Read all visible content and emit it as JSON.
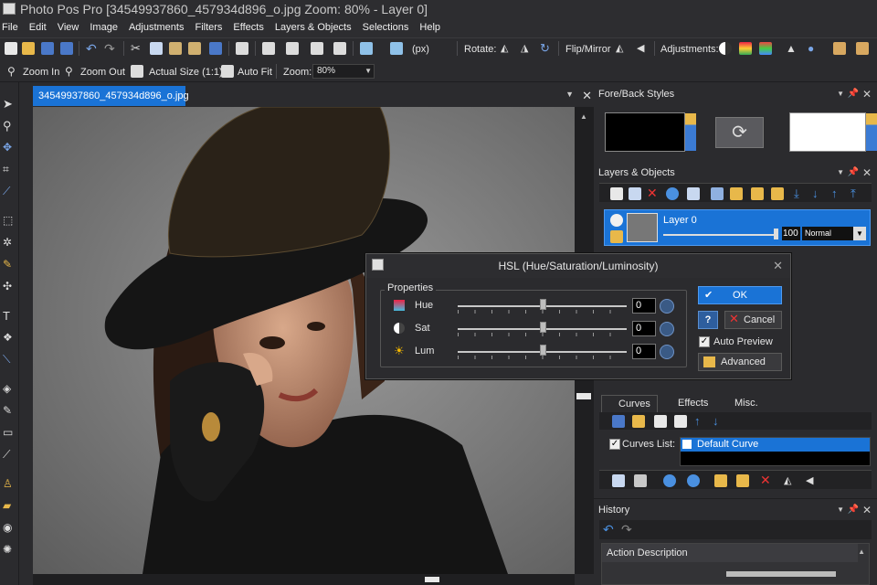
{
  "window": {
    "title": "Photo Pos Pro [34549937860_457934d896_o.jpg Zoom: 80% - Layer 0]"
  },
  "menu": [
    "File",
    "Edit",
    "View",
    "Image",
    "Adjustments",
    "Filters",
    "Effects",
    "Layers & Objects",
    "Selections",
    "Help"
  ],
  "toolbar1": {
    "units": "(px)",
    "rotate_label": "Rotate:",
    "flip_label": "Flip/Mirror",
    "adjustments_label": "Adjustments:"
  },
  "toolbar2": {
    "zoom_in": "Zoom In",
    "zoom_out": "Zoom Out",
    "actual_size": "Actual Size (1:1)",
    "auto_fit": "Auto Fit",
    "zoom_label": "Zoom:",
    "zoom_value": "80%"
  },
  "document": {
    "tab_label": "34549937860_457934d896_o.jpg"
  },
  "panels": {
    "fore_back": {
      "title": "Fore/Back Styles",
      "fore_color": "#000000",
      "back_color": "#ffffff"
    },
    "layers": {
      "title": "Layers & Objects",
      "layer_name": "Layer 0",
      "opacity": "100",
      "blend_mode": "Normal"
    },
    "curves": {
      "tabs": [
        "Curves",
        "Effects",
        "Misc."
      ],
      "list_label": "Curves List:",
      "list_item": "Default Curve"
    },
    "history": {
      "title": "History",
      "column": "Action Description"
    }
  },
  "dialog": {
    "title": "HSL (Hue/Saturation/Luminosity)",
    "group_label": "Properties",
    "rows": [
      {
        "label": "Hue",
        "value": "0",
        "level": 0.5
      },
      {
        "label": "Sat",
        "value": "0",
        "level": 0.5
      },
      {
        "label": "Lum",
        "value": "0",
        "level": 0.5
      }
    ],
    "ok_label": "OK",
    "help_label": "?",
    "cancel_label": "Cancel",
    "auto_preview_label": "Auto Preview",
    "auto_preview_checked": true,
    "advanced_label": "Advanced"
  },
  "colors": {
    "accent": "#1a73d6",
    "bg": "#2b2b2e"
  }
}
